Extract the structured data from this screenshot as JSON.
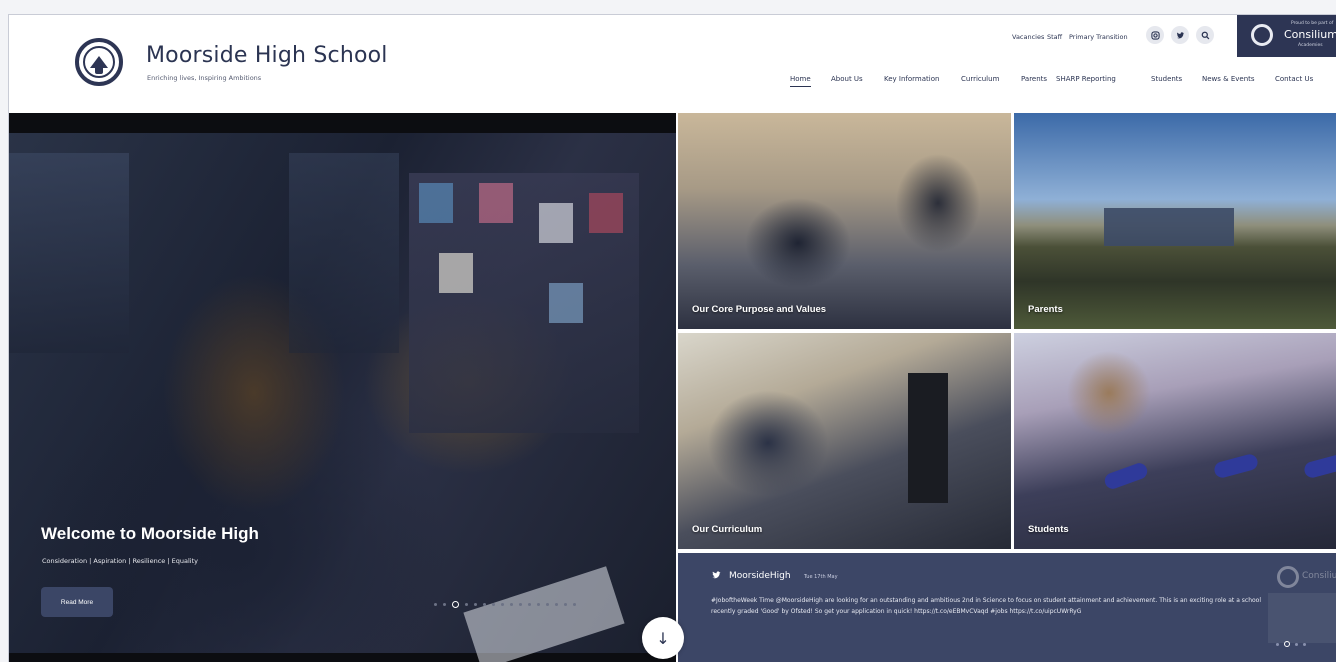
{
  "header": {
    "school_name": "Moorside High School",
    "tagline": "Enriching lives, Inspiring Ambitions",
    "utility_links": [
      "Vacancies",
      "Staff",
      "Primary Transition"
    ],
    "social_icons": [
      "instagram-icon",
      "twitter-icon",
      "search-icon"
    ],
    "partner": {
      "small_top": "Proud to be part of",
      "name": "Consilium",
      "small_bottom": "Academies"
    },
    "nav": [
      {
        "label": "Home",
        "active": true
      },
      {
        "label": "About Us"
      },
      {
        "label": "Key Information"
      },
      {
        "label": "Curriculum"
      },
      {
        "label": "Parents"
      },
      {
        "label": "SHARP Reporting"
      },
      {
        "label": "Students"
      },
      {
        "label": "News & Events"
      },
      {
        "label": "Contact Us"
      }
    ]
  },
  "hero": {
    "title": "Welcome to Moorside High",
    "subtitle": "Consideration | Aspiration | Resilience | Equality",
    "button_label": "Read More",
    "slide_count": 16,
    "active_slide": 2
  },
  "tiles": [
    {
      "caption": "Our Core Purpose and Values"
    },
    {
      "caption": "Parents"
    },
    {
      "caption": "Our Curriculum"
    },
    {
      "caption": "Students"
    }
  ],
  "tweet": {
    "handle": "MoorsideHigh",
    "date": "Tue 17th May",
    "text": "#JoboftheWeek Time @MoorsideHigh are looking for an outstanding and ambitious 2nd in Science to focus on student attainment and achievement. This is an exciting role at a school recently graded 'Good' by Ofsted! So get your application in quick! https://t.co/eEBMvCVaqd #jobs https://t.co/uipcUWrRyG",
    "brand_watermark": "Consilium"
  },
  "scroll": {
    "icon": "arrow-down-icon",
    "glyph": "↓"
  },
  "colors": {
    "navy": "#2d3554",
    "panel": "#3c4666",
    "button": "#3b4666"
  }
}
